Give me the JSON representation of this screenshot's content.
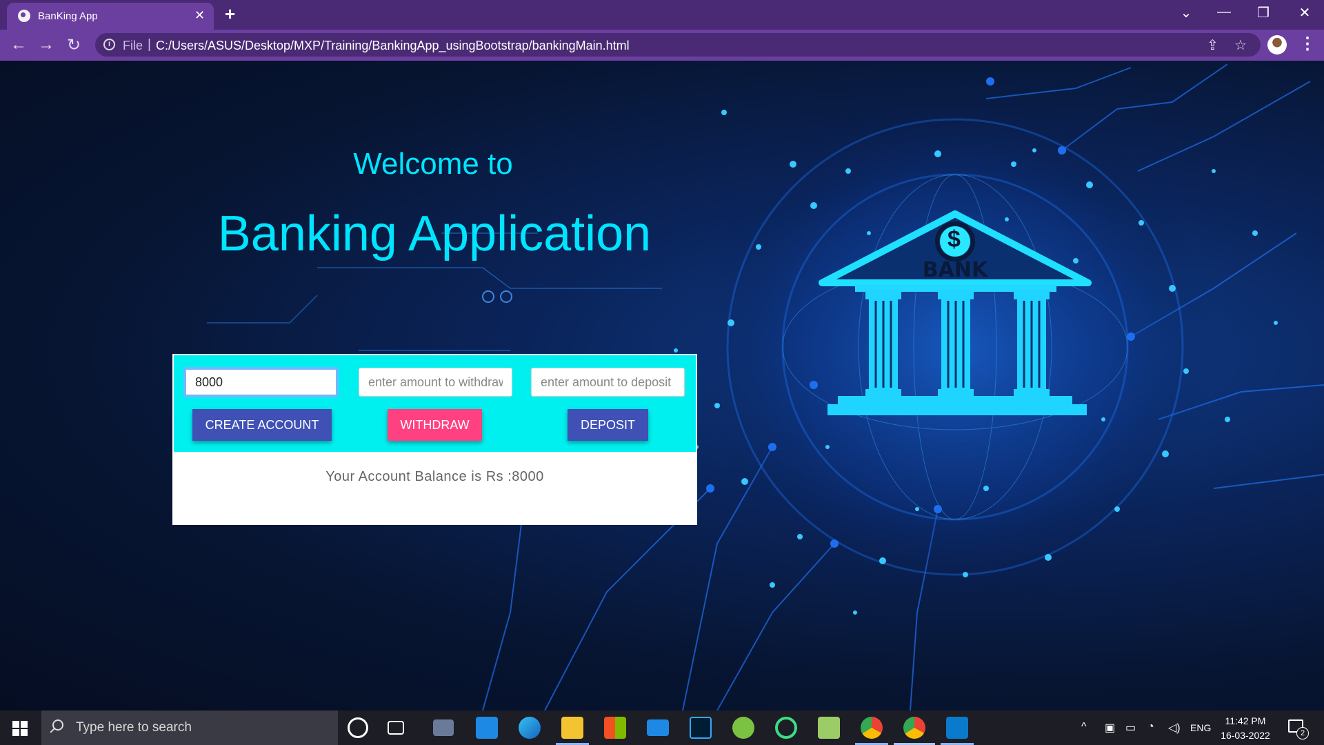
{
  "browser": {
    "tab_title": "BanKing App",
    "file_label": "File",
    "url": "C:/Users/ASUS/Desktop/MXP/Training/BankingApp_usingBootstrap/bankingMain.html"
  },
  "page": {
    "welcome": "Welcome to",
    "title": "Banking Application",
    "bank_sign": "BANK",
    "bank_symbol": "$",
    "account_input": {
      "value": "8000"
    },
    "withdraw_input": {
      "placeholder": "enter amount to withdraw"
    },
    "deposit_input": {
      "placeholder": "enter amount to deposit"
    },
    "create_label": "CREATE ACCOUNT",
    "withdraw_label": "WITHDRAW",
    "deposit_label": "DEPOSIT",
    "balance_text": "Your Account Balance is Rs :8000"
  },
  "taskbar": {
    "search_placeholder": "Type here to search",
    "language": "ENG",
    "time": "11:42 PM",
    "date": "16-03-2022",
    "notification_count": "2",
    "apps": [
      "cortana-icon",
      "task-view-icon",
      "camera-icon",
      "media-player-icon",
      "edge-icon",
      "file-explorer-icon",
      "store-icon",
      "mail-icon",
      "photoshop-icon",
      "green-app-icon",
      "circle-app-icon",
      "notepad-app-icon",
      "chrome-icon",
      "chrome-active-icon",
      "vscode-icon"
    ]
  },
  "colors": {
    "browser_frame": "#4a2a74",
    "browser_toolbar": "#6b3fa0",
    "accent_cyan": "#00e5ff",
    "card_top": "#00f0f0",
    "primary_button": "#3f51b5",
    "withdraw_button": "#ff4081"
  }
}
